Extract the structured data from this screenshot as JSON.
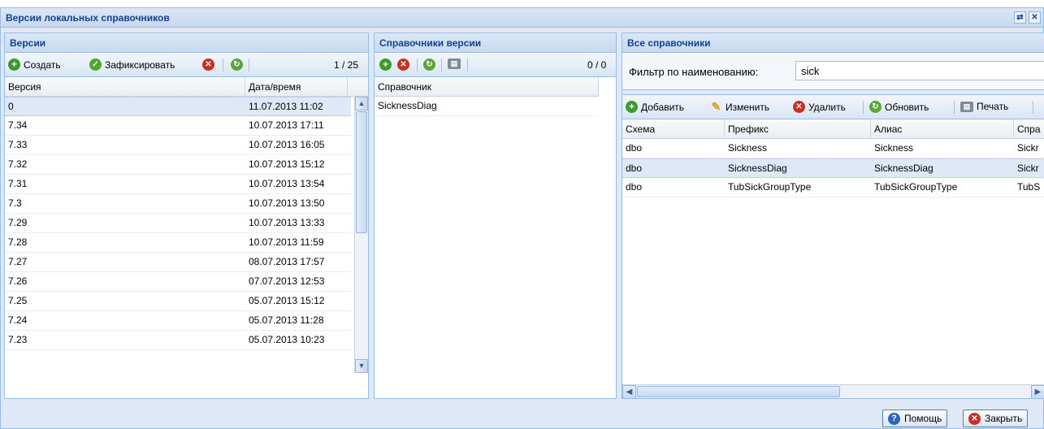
{
  "window": {
    "title": "Версии локальных справочников",
    "tools": [
      "⇄",
      "✕"
    ]
  },
  "versions_panel": {
    "title": "Версии",
    "toolbar": {
      "create_label": "Создать",
      "fix_label": "Зафиксировать",
      "pager": "1 / 25"
    },
    "columns": [
      "Версия",
      "Дата/время"
    ],
    "rows": [
      {
        "version": "0",
        "datetime": "11.07.2013 11:02"
      },
      {
        "version": "7.34",
        "datetime": "10.07.2013 17:11"
      },
      {
        "version": "7.33",
        "datetime": "10.07.2013 16:05"
      },
      {
        "version": "7.32",
        "datetime": "10.07.2013 15:12"
      },
      {
        "version": "7.31",
        "datetime": "10.07.2013 13:54"
      },
      {
        "version": "7.3",
        "datetime": "10.07.2013 13:50"
      },
      {
        "version": "7.29",
        "datetime": "10.07.2013 13:33"
      },
      {
        "version": "7.28",
        "datetime": "10.07.2013 11:59"
      },
      {
        "version": "7.27",
        "datetime": "08.07.2013 17:57"
      },
      {
        "version": "7.26",
        "datetime": "07.07.2013 12:53"
      },
      {
        "version": "7.25",
        "datetime": "05.07.2013 15:12"
      },
      {
        "version": "7.24",
        "datetime": "05.07.2013 11:28"
      },
      {
        "version": "7.23",
        "datetime": "05.07.2013 10:23"
      }
    ]
  },
  "version_dicts_panel": {
    "title": "Справочники версии",
    "pager": "0 / 0",
    "columns": [
      "Справочник"
    ],
    "rows": [
      "SicknessDiag"
    ]
  },
  "all_dicts_panel": {
    "title": "Все справочники",
    "filter_label": "Фильтр по наименованию:",
    "filter_value": "sick",
    "toolbar": {
      "add_label": "Добавить",
      "edit_label": "Изменить",
      "delete_label": "Удалить",
      "refresh_label": "Обновить",
      "print_label": "Печать"
    },
    "columns": [
      "Схема",
      "Префикс",
      "Алиас",
      "Спра"
    ],
    "rows": [
      {
        "schema": "dbo",
        "prefix": "Sickness",
        "alias": "Sickness",
        "dict": "Sickr"
      },
      {
        "schema": "dbo",
        "prefix": "SicknessDiag",
        "alias": "SicknessDiag",
        "dict": "Sickr"
      },
      {
        "schema": "dbo",
        "prefix": "TubSickGroupType",
        "alias": "TubSickGroupType",
        "dict": "TubS"
      }
    ]
  },
  "footer": {
    "help_label": "Помощь",
    "close_label": "Закрыть"
  }
}
